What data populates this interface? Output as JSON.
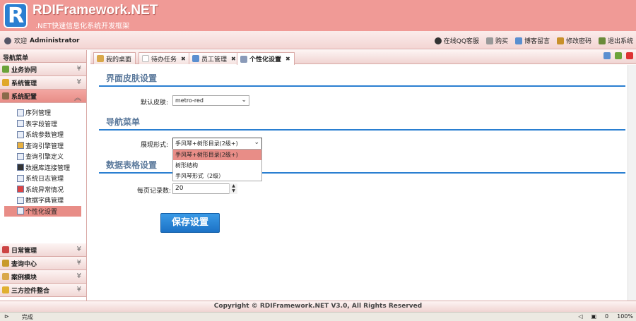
{
  "header": {
    "logo_letter": "R",
    "title": "RDIFramework.NET",
    "subtitle": ".NET快速信息化系统开发框架"
  },
  "userbar": {
    "welcome": "欢迎",
    "username": "Administrator",
    "links": [
      "在线QQ客服",
      "购买",
      "博客留言",
      "修改密码",
      "退出系统"
    ]
  },
  "sidebar": {
    "title": "导航菜单",
    "collapse_icon": "«",
    "top_groups": [
      "业务协同",
      "系统管理",
      "系统配置"
    ],
    "active_group": "系统配置",
    "items": [
      "序列管理",
      "表字段管理",
      "系统参数管理",
      "查询引擎管理",
      "查询引擎定义",
      "数据库连接管理",
      "系统日志管理",
      "系统异常情况",
      "数据字典管理",
      "个性化设置"
    ],
    "selected_item": "个性化设置",
    "bottom_groups": [
      "日常管理",
      "查询中心",
      "案例模块",
      "三方控件整合"
    ]
  },
  "tabs": [
    {
      "label": "我的桌面",
      "closable": false
    },
    {
      "label": "待办任务",
      "closable": true
    },
    {
      "label": "员工管理",
      "closable": true
    },
    {
      "label": "个性化设置",
      "closable": true,
      "active": true
    }
  ],
  "content": {
    "section1": {
      "title": "界面皮肤设置",
      "skin_label": "默认皮肤:",
      "skin_value": "metro-red"
    },
    "section2": {
      "title": "导航菜单",
      "style_label": "展现形式:",
      "style_value": "手风琴+树形目录(2级+)",
      "options": [
        "手风琴+树形目录(2级+)",
        "树形结构",
        "手风琴形式（2级）"
      ]
    },
    "section3": {
      "title": "数据表格设置",
      "pagesize_label": "每页记录数:",
      "pagesize_value": "20"
    },
    "save_label": "保存设置"
  },
  "footer": {
    "copyright": "Copyright © RDIFramework.NET V3.0, All Rights Reserved"
  },
  "statusbar": {
    "status": "完成",
    "zoom": "100%",
    "count": "0"
  },
  "colors": {
    "header": "#f09a96",
    "accent": "#e88d87",
    "link_blue": "#2a7fd1",
    "section_title": "#5c7a9c"
  }
}
